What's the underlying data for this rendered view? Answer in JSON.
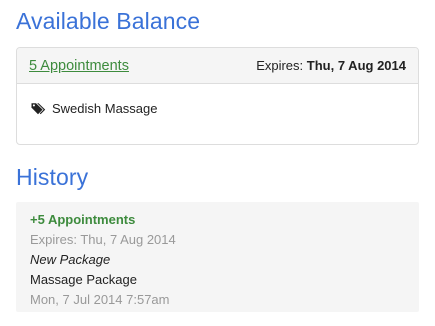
{
  "balance": {
    "title": "Available Balance",
    "appointments_link": "5 Appointments",
    "expires_label": "Expires:",
    "expires_date": "Thu, 7 Aug 2014",
    "service": "Swedish Massage",
    "icon": "tag-icon"
  },
  "history": {
    "title": "History",
    "items": [
      {
        "amount": "+5 Appointments",
        "expires": "Expires: Thu, 7 Aug 2014",
        "type": "New Package",
        "package": "Massage Package",
        "date": "Mon, 7 Jul 2014 7:57am"
      }
    ]
  },
  "colors": {
    "heading": "#3a72d8",
    "accent_green": "#3d8b3d",
    "muted": "#999999"
  }
}
